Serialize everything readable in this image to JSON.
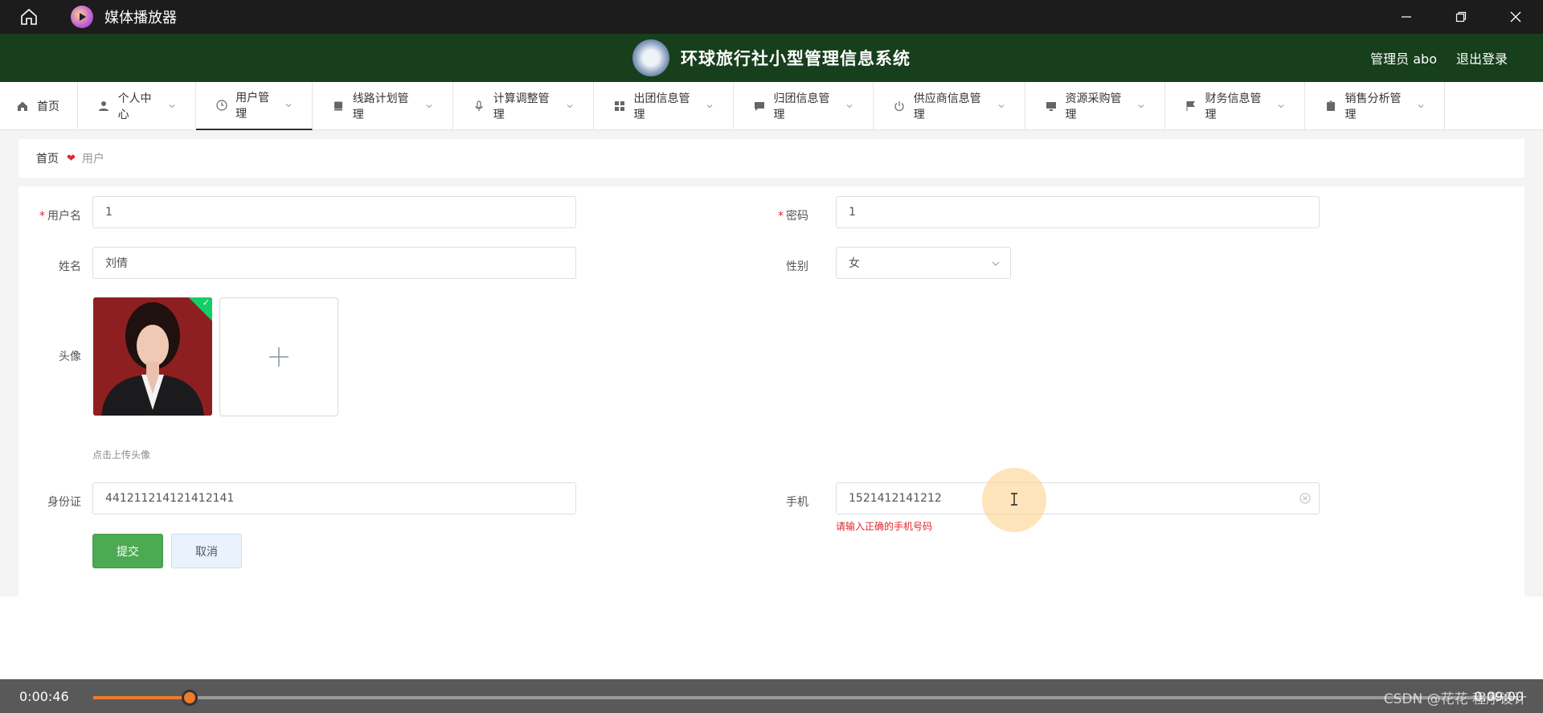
{
  "player": {
    "title": "媒体播放器",
    "time_elapsed": "0:00:46",
    "time_total": "0:09:00",
    "progress_percent": 6.8,
    "watermark": "CSDN @花花 程序设计"
  },
  "header": {
    "system_title": "环球旅行社小型管理信息系统",
    "admin_label": "管理员 abo",
    "logout_label": "退出登录"
  },
  "nav": {
    "items": [
      {
        "label": "首页",
        "icon": "home-icon"
      },
      {
        "label": "个人中心",
        "icon": "user-icon"
      },
      {
        "label": "用户管理",
        "icon": "clock-icon"
      },
      {
        "label": "线路计划管理",
        "icon": "book-icon"
      },
      {
        "label": "计算调整管理",
        "icon": "mic-icon"
      },
      {
        "label": "出团信息管理",
        "icon": "grid-icon"
      },
      {
        "label": "归团信息管理",
        "icon": "chat-icon"
      },
      {
        "label": "供应商信息管理",
        "icon": "power-icon"
      },
      {
        "label": "资源采购管理",
        "icon": "monitor-icon"
      },
      {
        "label": "财务信息管理",
        "icon": "flag-icon"
      },
      {
        "label": "销售分析管理",
        "icon": "clipboard-icon"
      }
    ]
  },
  "breadcrumb": {
    "home": "首页",
    "current": "用户"
  },
  "form": {
    "username_label": "用户名",
    "username_value": "1",
    "password_label": "密码",
    "password_value": "1",
    "name_label": "姓名",
    "name_value": "刘倩",
    "gender_label": "性别",
    "gender_value": "女",
    "avatar_label": "头像",
    "avatar_hint": "点击上传头像",
    "id_label": "身份证",
    "id_value": "441211214121412141",
    "phone_label": "手机",
    "phone_value": "1521412141212",
    "phone_error": "请输入正确的手机号码",
    "submit_label": "提交",
    "cancel_label": "取消"
  },
  "colors": {
    "header_bg": "#173f1c",
    "submit_bg": "#4caa52",
    "error": "#e0262d",
    "progress": "#f07b2b"
  }
}
